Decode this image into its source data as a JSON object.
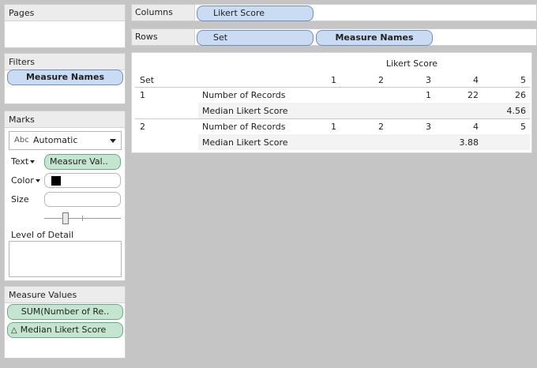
{
  "pages": {
    "title": "Pages"
  },
  "filters": {
    "title": "Filters",
    "pill": "Measure Names"
  },
  "marks": {
    "title": "Marks",
    "mark_type_prefix": "Abc",
    "mark_type": "Automatic",
    "text_label": "Text",
    "text_pill": "Measure Val..",
    "color_label": "Color",
    "color_swatch": "#000000",
    "size_label": "Size",
    "size_slider_level": 0.26,
    "detail_label": "Level of Detail"
  },
  "measure_values": {
    "title": "Measure Values",
    "items": [
      "SUM(Number of Re..",
      "Median Likert Score"
    ]
  },
  "columns_shelf": {
    "label": "Columns",
    "pills": [
      "Likert Score"
    ]
  },
  "rows_shelf": {
    "label": "Rows",
    "pills": [
      "Set",
      "Measure Names"
    ]
  },
  "table": {
    "column_group_header": "Likert Score",
    "row_header": "Set",
    "columns": [
      "1",
      "2",
      "3",
      "4",
      "5"
    ],
    "rows": [
      {
        "set": "1",
        "measure": "Number of Records",
        "values": [
          "",
          "",
          "1",
          "22",
          "26"
        ]
      },
      {
        "set": "",
        "measure": "Median Likert Score",
        "values": [
          "",
          "",
          "",
          "",
          "4.56"
        ]
      },
      {
        "set": "2",
        "measure": "Number of Records",
        "values": [
          "1",
          "2",
          "3",
          "4",
          "5"
        ]
      },
      {
        "set": "",
        "measure": "Median Likert Score",
        "values": [
          "",
          "",
          "",
          "3.88",
          ""
        ]
      }
    ]
  },
  "colors": {
    "dimension_pill": "#c9dcf3",
    "measure_pill": "#c4e6d0",
    "background": "#c5c5c5"
  }
}
